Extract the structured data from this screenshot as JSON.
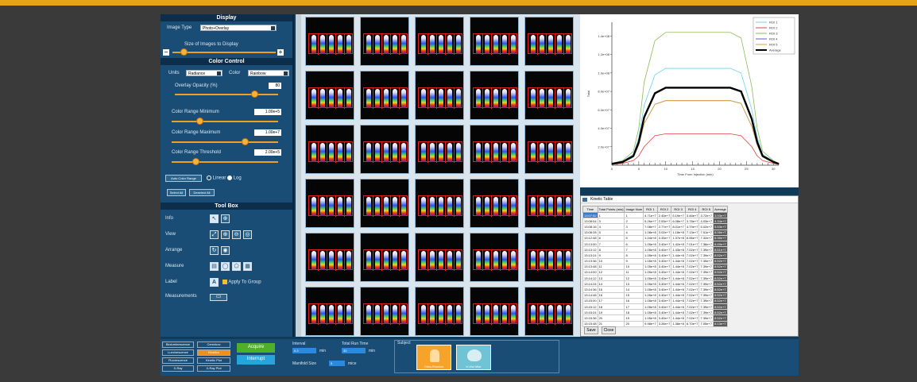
{
  "display": {
    "header": "Display",
    "image_type_label": "Image Type",
    "image_type_value": "Photo+Overlay",
    "size_label": "Size of Images to Display"
  },
  "color_control": {
    "header": "Color Control",
    "units_label": "Units",
    "units_value": "Radiance",
    "color_label": "Color",
    "color_value": "Rainbow",
    "overlay_label": "Overlay Opacity (%)",
    "overlay_value": "80",
    "min_label": "Color Range Minimum",
    "min_value": "1.00e+5",
    "max_label": "Color Range Maximum",
    "max_value": "1.00e+7",
    "threshold_label": "Color Range Threshold",
    "threshold_value": "2.00e+5",
    "auto_button": "Auto Color Range",
    "linear_label": "Linear",
    "log_label": "Log",
    "select_all": "Select All",
    "deselect_all": "Deselect All"
  },
  "tool_box": {
    "header": "Tool Box",
    "info_label": "Info",
    "view_label": "View",
    "arrange_label": "Arrange",
    "measure_label": "Measure",
    "label_label": "Label",
    "apply_group": "Apply To Group",
    "measurements_label": "Measurements"
  },
  "chart_data": {
    "type": "line",
    "xlabel": "Time From Injection (min)",
    "ylabel": "Total",
    "x_ticks": [
      "0",
      "5",
      "10",
      "15",
      "20",
      "25",
      "30"
    ],
    "y_ticks": [
      "2.0e+07",
      "4.0e+07",
      "6.0e+07",
      "8.0e+07",
      "1.0e+08",
      "1.2e+08",
      "1.4e+08"
    ],
    "xlim": [
      0,
      31
    ],
    "ylim": [
      0,
      155000000
    ],
    "x": [
      0,
      2,
      4,
      5,
      6,
      8,
      10,
      12,
      14,
      16,
      18,
      20,
      22,
      24,
      26,
      27,
      28,
      30,
      31
    ],
    "series": [
      {
        "name": "ROI 1",
        "color": "#6fd0f0",
        "values": [
          2000000.0,
          4000000.0,
          12000000.0,
          30000000.0,
          65000000.0,
          98000000.0,
          105000000.0,
          105000000.0,
          105000000.0,
          105000000.0,
          105000000.0,
          105000000.0,
          105000000.0,
          100000000.0,
          60000000.0,
          30000000.0,
          12000000.0,
          4000000.0,
          2000000.0
        ]
      },
      {
        "name": "ROI 2",
        "color": "#e04040",
        "values": [
          1000000.0,
          2000000.0,
          5000000.0,
          10000000.0,
          20000000.0,
          32000000.0,
          34000000.0,
          34000000.0,
          34000000.0,
          34000000.0,
          34000000.0,
          34000000.0,
          34000000.0,
          32000000.0,
          20000000.0,
          10000000.0,
          5000000.0,
          2000000.0,
          1000000.0
        ]
      },
      {
        "name": "ROI 3",
        "color": "#8dbb5a",
        "values": [
          2000000.0,
          5000000.0,
          15000000.0,
          40000000.0,
          90000000.0,
          135000000.0,
          144000000.0,
          144000000.0,
          144000000.0,
          144000000.0,
          144000000.0,
          144000000.0,
          144000000.0,
          138000000.0,
          85000000.0,
          40000000.0,
          15000000.0,
          5000000.0,
          2000000.0
        ]
      },
      {
        "name": "ROI 4",
        "color": "#6a5ac8",
        "values": [
          1000000.0,
          3000000.0,
          9000000.0,
          22000000.0,
          45000000.0,
          66000000.0,
          70000000.0,
          70000000.0,
          70000000.0,
          70000000.0,
          70000000.0,
          70000000.0,
          70000000.0,
          67000000.0,
          42000000.0,
          22000000.0,
          9000000.0,
          3000000.0,
          1000000.0
        ]
      },
      {
        "name": "ROI 5",
        "color": "#e0a030",
        "values": [
          1000000.0,
          3000000.0,
          9000000.0,
          22000000.0,
          45000000.0,
          66000000.0,
          70000000.0,
          70000000.0,
          70000000.0,
          70000000.0,
          70000000.0,
          70000000.0,
          70000000.0,
          67000000.0,
          42000000.0,
          22000000.0,
          9000000.0,
          3000000.0,
          1000000.0
        ]
      },
      {
        "name": "Average",
        "color": "#000000",
        "values": [
          1500000.0,
          3500000.0,
          10000000.0,
          25000000.0,
          52000000.0,
          78000000.0,
          84000000.0,
          84000000.0,
          84000000.0,
          84000000.0,
          84000000.0,
          84000000.0,
          84000000.0,
          80000000.0,
          50000000.0,
          25000000.0,
          10000000.0,
          3500000.0,
          1500000.0
        ]
      }
    ]
  },
  "table": {
    "title": "Kinetic Table",
    "columns": [
      "Time",
      "Total Points (min)",
      "Image Num",
      "ROI 1",
      "ROI 2",
      "ROI 3",
      "ROI 4",
      "ROI 5",
      "Average"
    ],
    "rows": [
      [
        "13:07:52",
        "1",
        "1",
        "4.71e+7",
        "2.40e+7",
        "5.19e+7",
        "3.46e+7",
        "3.72e+7",
        "3.93e+7"
      ],
      [
        "13:08:04",
        "3",
        "2",
        "5.26e+7",
        "2.53e+7",
        "6.08e+7",
        "3.78e+7",
        "4.03e+7",
        "4.34e+7"
      ],
      [
        "13:08:16",
        "4",
        "3",
        "7.08e+7",
        "2.77e+7",
        "8.01e+7",
        "4.79e+7",
        "5.02e+7",
        "5.53e+7"
      ],
      [
        "13:08:28",
        "5",
        "4",
        "1.08e+8",
        "3.02e+7",
        "1.18e+8",
        "7.13e+7",
        "7.51e+7",
        "8.06e+7"
      ],
      [
        "13:12:48",
        "6",
        "5",
        "1.04e+8",
        "3.33e+7",
        "1.37e+8",
        "6.96e+7",
        "7.32e+7",
        "8.35e+7"
      ],
      [
        "13:13:00",
        "7",
        "6",
        "1.05e+8",
        "3.40e+7",
        "1.42e+8",
        "7.01e+7",
        "7.38e+7",
        "8.49e+7"
      ],
      [
        "13:13:12",
        "8",
        "7",
        "1.05e+8",
        "3.40e+7",
        "1.43e+8",
        "7.02e+7",
        "7.39e+7",
        "8.51e+7"
      ],
      [
        "13:13:24",
        "9",
        "8",
        "1.05e+8",
        "3.40e+7",
        "1.44e+8",
        "7.02e+7",
        "7.39e+7",
        "8.52e+7"
      ],
      [
        "13:13:36",
        "10",
        "9",
        "1.05e+8",
        "3.40e+7",
        "1.44e+8",
        "7.02e+7",
        "7.39e+7",
        "8.52e+7"
      ],
      [
        "13:13:48",
        "11",
        "10",
        "1.05e+8",
        "3.40e+7",
        "1.44e+8",
        "7.02e+7",
        "7.39e+7",
        "8.52e+7"
      ],
      [
        "13:14:00",
        "12",
        "11",
        "1.05e+8",
        "3.40e+7",
        "1.44e+8",
        "7.02e+7",
        "7.39e+7",
        "8.52e+7"
      ],
      [
        "13:14:12",
        "13",
        "12",
        "1.05e+8",
        "3.40e+7",
        "1.44e+8",
        "7.02e+7",
        "7.39e+7",
        "8.52e+7"
      ],
      [
        "13:14:24",
        "14",
        "13",
        "1.05e+8",
        "3.40e+7",
        "1.44e+8",
        "7.02e+7",
        "7.39e+7",
        "8.52e+7"
      ],
      [
        "13:14:36",
        "15",
        "14",
        "1.05e+8",
        "3.40e+7",
        "1.44e+8",
        "7.02e+7",
        "7.39e+7",
        "8.52e+7"
      ],
      [
        "13:14:48",
        "16",
        "15",
        "1.05e+8",
        "3.40e+7",
        "1.44e+8",
        "7.02e+7",
        "7.39e+7",
        "8.52e+7"
      ],
      [
        "13:15:00",
        "17",
        "16",
        "1.05e+8",
        "3.40e+7",
        "1.44e+8",
        "7.02e+7",
        "7.39e+7",
        "8.52e+7"
      ],
      [
        "13:15:12",
        "18",
        "17",
        "1.05e+8",
        "3.40e+7",
        "1.44e+8",
        "7.02e+7",
        "7.39e+7",
        "8.52e+7"
      ],
      [
        "13:15:24",
        "19",
        "18",
        "1.05e+8",
        "3.40e+7",
        "1.44e+8",
        "7.02e+7",
        "7.39e+7",
        "8.52e+7"
      ],
      [
        "13:15:36",
        "20",
        "19",
        "1.05e+8",
        "3.40e+7",
        "1.44e+8",
        "7.02e+7",
        "7.39e+7",
        "8.52e+7"
      ],
      [
        "13:15:48",
        "21",
        "20",
        "9.98e+7",
        "3.26e+7",
        "1.38e+8",
        "6.70e+7",
        "7.05e+7",
        "8.13e+7"
      ]
    ],
    "save": "Save",
    "close": "Close"
  },
  "bottom": {
    "modes_left": [
      "Bioluminescence",
      "Luminescence",
      "Fluorescence",
      "X-Ray"
    ],
    "modes_right": [
      "Cerenkov",
      "Kinetics",
      "Kinetic Plot",
      "X-Ray Plot"
    ],
    "acquire": "Acquire",
    "interrupt": "Interrupt",
    "interval_label": "Interval",
    "interval_value": "0.2",
    "interval_unit": "min",
    "total_label": "Total Run Time",
    "total_value": "30",
    "total_unit": "min",
    "manifold_label": "Manifold Size",
    "manifold_value": "5",
    "manifold_unit": "mice",
    "subject_label": "Subject",
    "subject_1": "Ortho-Phantom",
    "subject_2": "In Vivo Mice"
  },
  "colors": {
    "panel": "#1a4d75",
    "header": "#0d2e4a",
    "accent": "#f0a020",
    "selected": "#f0901a",
    "green_button": "#4fae2a"
  },
  "icons": {
    "info": [
      "pointer-icon",
      "crosshair-icon"
    ],
    "view": [
      "fit-view-icon",
      "zoom-in-icon",
      "zoom-out-icon",
      "zoom-reset-icon"
    ],
    "arrange": [
      "rotate-icon",
      "layout-icon"
    ],
    "measure": [
      "ruler-icon",
      "circle-roi-icon",
      "polygon-roi-icon",
      "grid-roi-icon"
    ]
  }
}
